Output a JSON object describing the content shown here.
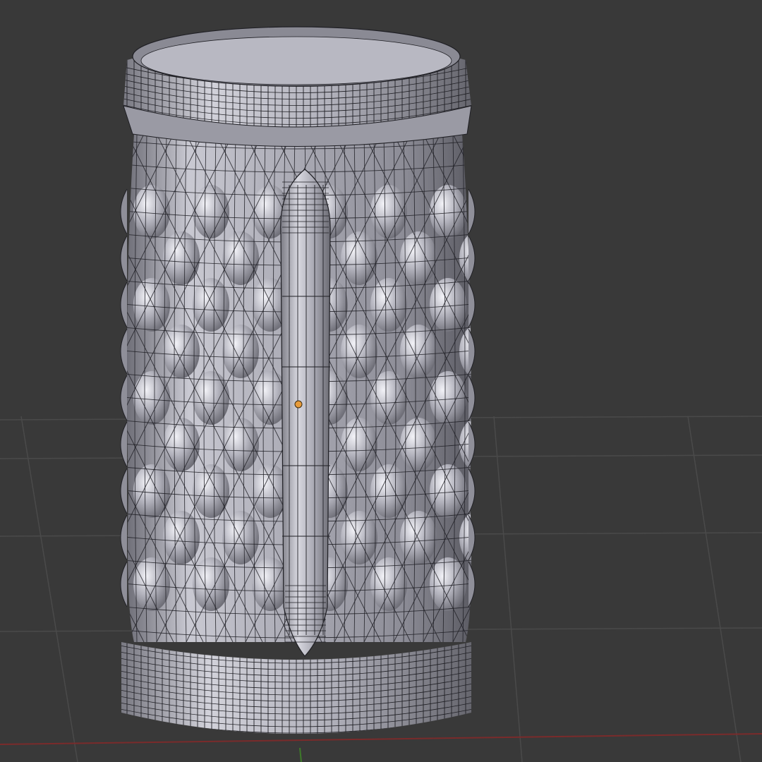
{
  "viewport": {
    "view": "3d-viewport",
    "background_color": "#393939",
    "grid_color": "#4a4a4a",
    "x_axis_color": "#7a2b2b",
    "y_axis_color": "#3e7a2a"
  },
  "object": {
    "name": "mug-mesh",
    "display": "wireframe-over-solid",
    "body_color": "#a9a9b3",
    "wire_color": "#1f1f24",
    "origin_color": "#e79b3a",
    "features": [
      "top-rim",
      "diamond-quilted-body",
      "vertical-handle",
      "base-rim"
    ]
  }
}
